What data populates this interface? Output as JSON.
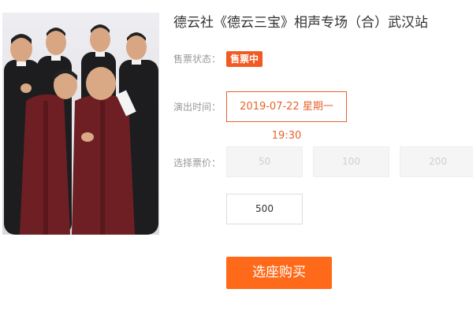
{
  "product": {
    "title": "德云社《德云三宝》相声专场（合）武汉站"
  },
  "status": {
    "label": "售票状态：",
    "value": "售票中"
  },
  "showtime": {
    "label": "演出时间：",
    "options": [
      "2019-07-22 星期一 19:30"
    ]
  },
  "prices": {
    "label": "选择票价：",
    "options": [
      {
        "value": "50",
        "available": false
      },
      {
        "value": "100",
        "available": false
      },
      {
        "value": "200",
        "available": false
      },
      {
        "value": "500",
        "available": true
      }
    ]
  },
  "action": {
    "buy_label": "选座购买"
  },
  "colors": {
    "accent": "#f15a22",
    "button": "#ff6a1a",
    "muted_text": "#999999",
    "disabled_bg": "#f5f5f5"
  }
}
